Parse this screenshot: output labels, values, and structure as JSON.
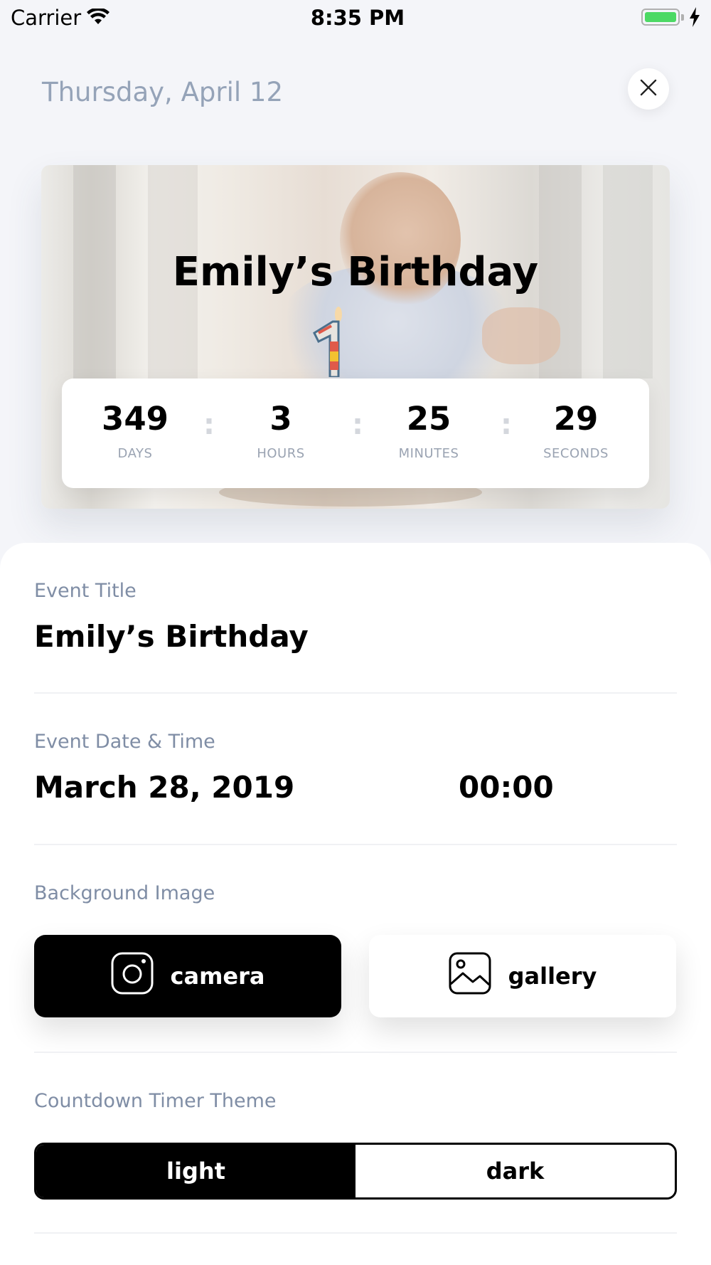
{
  "status_bar": {
    "carrier": "Carrier",
    "time": "8:35 PM"
  },
  "header": {
    "date": "Thursday, April 12"
  },
  "hero": {
    "title": "Emily’s Birthday",
    "timer": [
      {
        "value": "349",
        "unit": "DAYS"
      },
      {
        "value": "3",
        "unit": "HOURS"
      },
      {
        "value": "25",
        "unit": "MINUTES"
      },
      {
        "value": "29",
        "unit": "SECONDS"
      }
    ],
    "separator": ":"
  },
  "form": {
    "event_title": {
      "label": "Event Title",
      "value": "Emily’s Birthday"
    },
    "event_datetime": {
      "label": "Event Date & Time",
      "date": "March 28, 2019",
      "time": "00:00"
    },
    "background_image": {
      "label": "Background Image",
      "camera_label": "camera",
      "gallery_label": "gallery"
    },
    "theme": {
      "label": "Countdown Timer Theme",
      "options": [
        "light",
        "dark"
      ],
      "selected": "light"
    }
  },
  "colors": {
    "battery": "#4cd964",
    "label": "#7f8da5",
    "date": "#95a3b8"
  },
  "icons": [
    "wifi-icon",
    "battery-icon",
    "charging-icon",
    "close-icon",
    "camera-icon",
    "gallery-icon",
    "candle-1"
  ]
}
